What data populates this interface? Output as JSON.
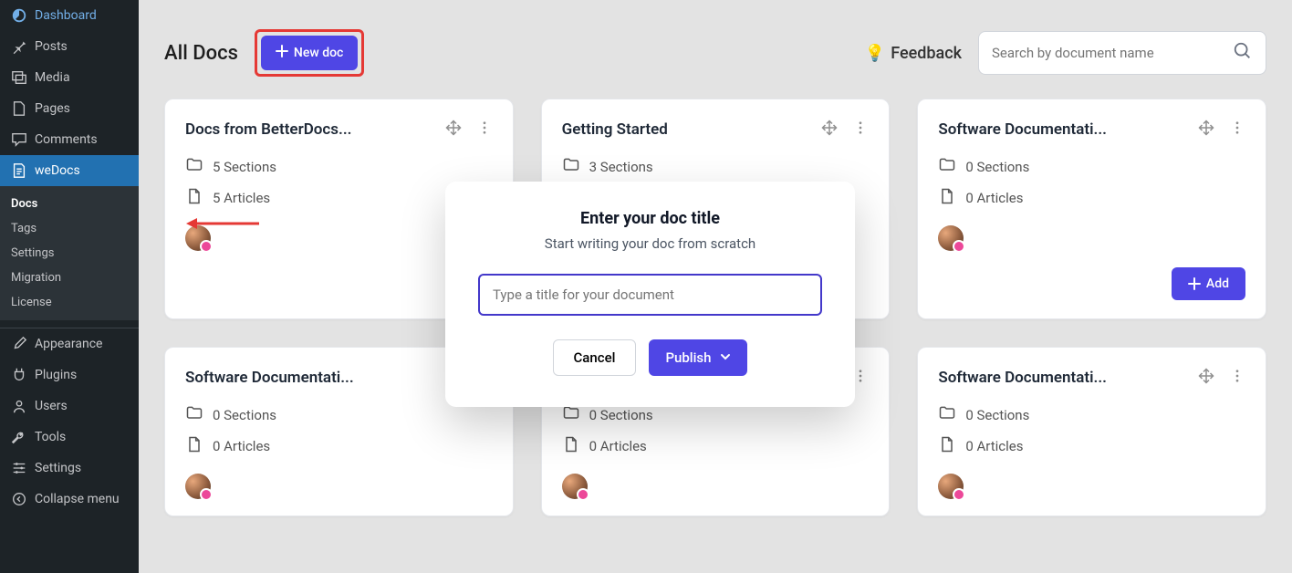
{
  "sidebar": {
    "items": [
      {
        "key": "dashboard",
        "label": "Dashboard"
      },
      {
        "key": "posts",
        "label": "Posts"
      },
      {
        "key": "media",
        "label": "Media"
      },
      {
        "key": "pages",
        "label": "Pages"
      },
      {
        "key": "comments",
        "label": "Comments"
      },
      {
        "key": "wedocs",
        "label": "weDocs",
        "active": true
      },
      {
        "key": "appearance",
        "label": "Appearance"
      },
      {
        "key": "plugins",
        "label": "Plugins"
      },
      {
        "key": "users",
        "label": "Users"
      },
      {
        "key": "tools",
        "label": "Tools"
      },
      {
        "key": "settings",
        "label": "Settings"
      },
      {
        "key": "collapse",
        "label": "Collapse menu"
      }
    ],
    "sub": [
      {
        "key": "docs",
        "label": "Docs",
        "current": true
      },
      {
        "key": "tags",
        "label": "Tags"
      },
      {
        "key": "sub_settings",
        "label": "Settings"
      },
      {
        "key": "migration",
        "label": "Migration"
      },
      {
        "key": "license",
        "label": "License"
      }
    ]
  },
  "header": {
    "title": "All Docs",
    "new_doc_label": "New doc",
    "feedback_label": "Feedback",
    "search_placeholder": "Search by document name"
  },
  "cards": [
    {
      "title": "Docs from BetterDocs...",
      "sections": "5 Sections",
      "articles": "5 Articles",
      "show_avatar": true,
      "show_add": true
    },
    {
      "title": "Getting Started",
      "sections": "3 Sections",
      "articles": "",
      "show_avatar": false,
      "show_add": false
    },
    {
      "title": "Software Documentati...",
      "sections": "0 Sections",
      "articles": "0 Articles",
      "show_avatar": true,
      "show_add": true
    },
    {
      "title": "Software Documentati...",
      "sections": "0 Sections",
      "articles": "0 Articles",
      "show_avatar": true,
      "show_add": false
    },
    {
      "title": "Software Documentati...",
      "sections": "0 Sections",
      "articles": "0 Articles",
      "show_avatar": true,
      "show_add": false
    },
    {
      "title": "Software Documentati...",
      "sections": "0 Sections",
      "articles": "0 Articles",
      "show_avatar": true,
      "show_add": false
    }
  ],
  "add_label": "Add",
  "modal": {
    "title": "Enter your doc title",
    "subtitle": "Start writing your doc from scratch",
    "placeholder": "Type a title for your document",
    "cancel": "Cancel",
    "publish": "Publish"
  }
}
